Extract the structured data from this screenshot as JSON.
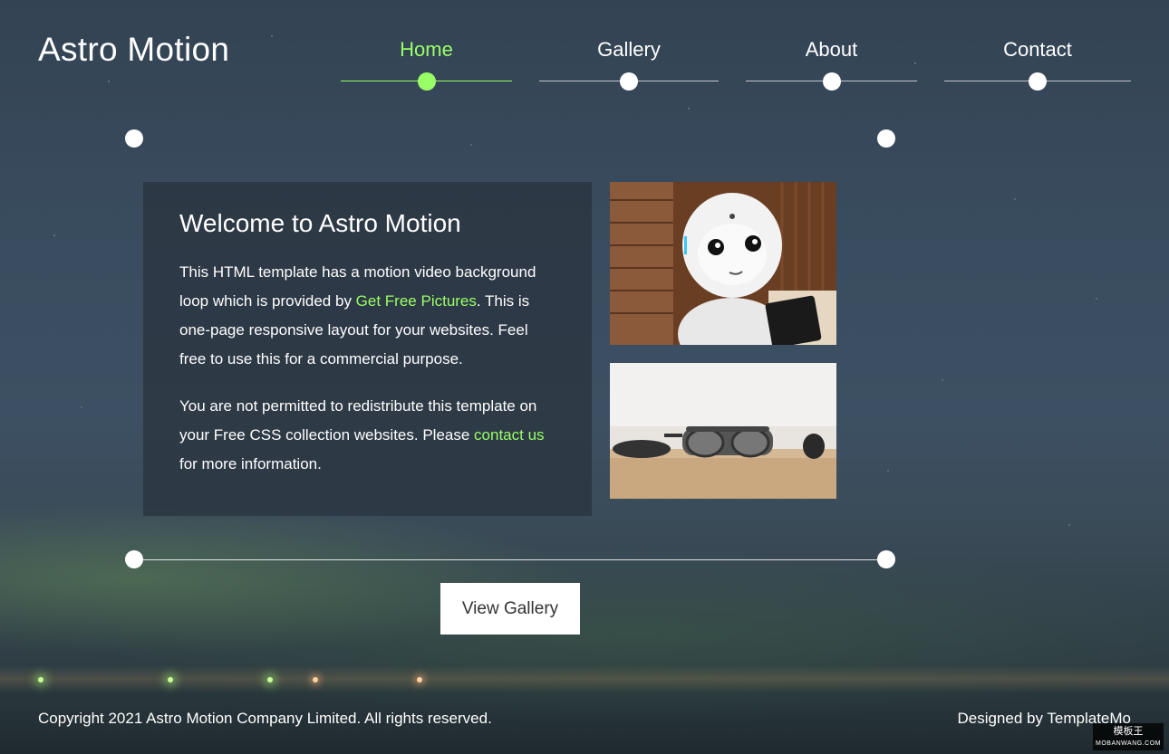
{
  "site": {
    "logo": "Astro Motion"
  },
  "nav": {
    "items": [
      {
        "label": "Home",
        "active": true
      },
      {
        "label": "Gallery",
        "active": false
      },
      {
        "label": "About",
        "active": false
      },
      {
        "label": "Contact",
        "active": false
      }
    ]
  },
  "welcome": {
    "title": "Welcome to Astro Motion",
    "p1_before": "This HTML template has a motion video background loop which is provided by ",
    "p1_link": "Get Free Pictures",
    "p1_after": ". This is one-page responsive layout for your websites. Feel free to use this for a commercial purpose.",
    "p2_before": "You are not permitted to redistribute this template on your Free CSS collection websites. Please ",
    "p2_link": "contact us",
    "p2_after": " for more information."
  },
  "gallery_button": {
    "label": "View Gallery"
  },
  "footer": {
    "copyright": "Copyright 2021 Astro Motion Company Limited. All rights reserved.",
    "designed_prefix": "Designed by ",
    "designed_link": "TemplateMo"
  },
  "watermark": {
    "title": "模板王",
    "sub": "MOBANWANG.COM"
  },
  "colors": {
    "accent": "#99ff66",
    "button_bg": "#ffffff",
    "panel_bg": "rgba(40,50,60,0.72)"
  },
  "icons": {
    "nav_marker": "circle-dot",
    "frame_marker": "circle-dot"
  }
}
